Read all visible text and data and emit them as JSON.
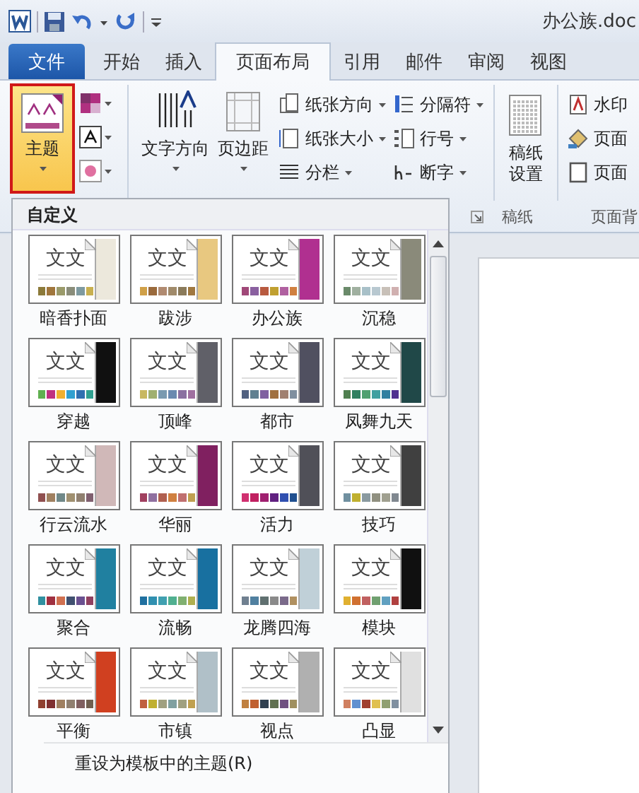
{
  "window": {
    "title": "办公族.doc"
  },
  "tabs": [
    {
      "label": "文件",
      "kind": "file",
      "selected": false
    },
    {
      "label": "开始",
      "kind": "tab",
      "selected": false
    },
    {
      "label": "插入",
      "kind": "tab",
      "selected": false
    },
    {
      "label": "页面布局",
      "kind": "tab",
      "selected": true
    },
    {
      "label": "引用",
      "kind": "tab",
      "selected": false
    },
    {
      "label": "邮件",
      "kind": "tab",
      "selected": false
    },
    {
      "label": "审阅",
      "kind": "tab",
      "selected": false
    },
    {
      "label": "视图",
      "kind": "tab",
      "selected": false
    }
  ],
  "ribbon": {
    "themes_button": {
      "label": "主题",
      "pressed": true
    },
    "large_buttons": [
      {
        "label": "文字方向"
      },
      {
        "label": "页边距"
      }
    ],
    "small_columns": [
      [
        {
          "label": "纸张方向"
        },
        {
          "label": "纸张大小"
        },
        {
          "label": "分栏"
        }
      ],
      [
        {
          "label": "分隔符"
        },
        {
          "label": "行号"
        },
        {
          "label": "断字"
        }
      ]
    ],
    "paper_button": {
      "label": "稿纸设置"
    },
    "background_items": [
      {
        "label": "水印"
      },
      {
        "label": "页面"
      },
      {
        "label": "页面"
      }
    ],
    "group_labels": [
      {
        "label": "稿纸"
      },
      {
        "label": "页面背"
      }
    ]
  },
  "theme_gallery": {
    "heading": "自定义",
    "themes": [
      {
        "name": "暗香扑面",
        "sample": "文文",
        "color": "#ece8dc",
        "swatches": [
          {
            "color": "#8c7a3a"
          },
          {
            "color": "#a0763c"
          },
          {
            "color": "#9a9a6a"
          },
          {
            "color": "#8a8d7a"
          },
          {
            "color": "#7e9aa0"
          },
          {
            "color": "#c8b050"
          }
        ]
      },
      {
        "name": "跋涉",
        "sample": "文文",
        "color": "#e8c880",
        "swatches": [
          {
            "color": "#d0a048"
          },
          {
            "color": "#9a6a3c"
          },
          {
            "color": "#b08a70"
          },
          {
            "color": "#a08a6a"
          },
          {
            "color": "#8a7a5a"
          },
          {
            "color": "#a07840"
          }
        ]
      },
      {
        "name": "办公族",
        "sample": "文文",
        "color": "#b03090",
        "swatches": [
          {
            "color": "#a04878"
          },
          {
            "color": "#8a60a0"
          },
          {
            "color": "#b85a40"
          },
          {
            "color": "#c0a030"
          },
          {
            "color": "#b060a0"
          },
          {
            "color": "#d08040"
          }
        ]
      },
      {
        "name": "沉稳",
        "sample": "文文",
        "color": "#8a8a7a",
        "swatches": [
          {
            "color": "#6a8a6a"
          },
          {
            "color": "#a0b0a0"
          },
          {
            "color": "#a8c0c8"
          },
          {
            "color": "#b8c8d0"
          },
          {
            "color": "#c8c0b8"
          },
          {
            "color": "#d0b0b0"
          }
        ]
      },
      {
        "name": "穿越",
        "sample": "文文",
        "color": "#101010",
        "swatches": [
          {
            "color": "#60b050"
          },
          {
            "color": "#c03080"
          },
          {
            "color": "#f0b030"
          },
          {
            "color": "#30a0d0"
          },
          {
            "color": "#3070b0"
          },
          {
            "color": "#30a090"
          }
        ]
      },
      {
        "name": "顶峰",
        "sample": "文文",
        "color": "#606068",
        "swatches": [
          {
            "color": "#c8b860"
          },
          {
            "color": "#a0b070"
          },
          {
            "color": "#7a9ab0"
          },
          {
            "color": "#6a8ab0"
          },
          {
            "color": "#8a70a0"
          },
          {
            "color": "#a070a0"
          }
        ]
      },
      {
        "name": "都市",
        "sample": "文文",
        "color": "#505060",
        "swatches": [
          {
            "color": "#506080"
          },
          {
            "color": "#608090"
          },
          {
            "color": "#8060a0"
          },
          {
            "color": "#a07040"
          },
          {
            "color": "#a08070"
          },
          {
            "color": "#8090a0"
          }
        ]
      },
      {
        "name": "凤舞九天",
        "sample": "文文",
        "color": "#204848",
        "swatches": [
          {
            "color": "#508050"
          },
          {
            "color": "#308060"
          },
          {
            "color": "#50a070"
          },
          {
            "color": "#40a0a0"
          },
          {
            "color": "#3080a0"
          },
          {
            "color": "#503090"
          }
        ]
      },
      {
        "name": "行云流水",
        "sample": "文文",
        "color": "#d0b8b8",
        "swatches": [
          {
            "color": "#905050"
          },
          {
            "color": "#a08060"
          },
          {
            "color": "#708888"
          },
          {
            "color": "#a09070"
          },
          {
            "color": "#908070"
          },
          {
            "color": "#806070"
          }
        ]
      },
      {
        "name": "华丽",
        "sample": "文文",
        "color": "#802060",
        "swatches": [
          {
            "color": "#a04060"
          },
          {
            "color": "#9070a0"
          },
          {
            "color": "#b06050"
          },
          {
            "color": "#d08040"
          },
          {
            "color": "#c07070"
          },
          {
            "color": "#c0a050"
          }
        ]
      },
      {
        "name": "活力",
        "sample": "文文",
        "color": "#505058",
        "swatches": [
          {
            "color": "#d03070"
          },
          {
            "color": "#c02060"
          },
          {
            "color": "#a02070"
          },
          {
            "color": "#602080"
          },
          {
            "color": "#3050b0"
          },
          {
            "color": "#205090"
          }
        ]
      },
      {
        "name": "技巧",
        "sample": "文文",
        "color": "#404040",
        "swatches": [
          {
            "color": "#7090a0"
          },
          {
            "color": "#c0b030"
          },
          {
            "color": "#8a9aa0"
          },
          {
            "color": "#909080"
          },
          {
            "color": "#a0a090"
          },
          {
            "color": "#808890"
          }
        ]
      },
      {
        "name": "聚合",
        "sample": "文文",
        "color": "#2080a0",
        "swatches": [
          {
            "color": "#3090a0"
          },
          {
            "color": "#a03040"
          },
          {
            "color": "#d07050"
          },
          {
            "color": "#405070"
          },
          {
            "color": "#6a5090"
          },
          {
            "color": "#904060"
          }
        ]
      },
      {
        "name": "流畅",
        "sample": "文文",
        "color": "#1870a0",
        "swatches": [
          {
            "color": "#2070a0"
          },
          {
            "color": "#3090b0"
          },
          {
            "color": "#40a0b0"
          },
          {
            "color": "#50b090"
          },
          {
            "color": "#80b070"
          },
          {
            "color": "#b0b050"
          }
        ]
      },
      {
        "name": "龙腾四海",
        "sample": "文文",
        "color": "#c0d0d8",
        "swatches": [
          {
            "color": "#708090"
          },
          {
            "color": "#5080a0"
          },
          {
            "color": "#607070"
          },
          {
            "color": "#8a8a8a"
          },
          {
            "color": "#7a6a8a"
          },
          {
            "color": "#b09060"
          }
        ]
      },
      {
        "name": "模块",
        "sample": "文文",
        "color": "#101010",
        "swatches": [
          {
            "color": "#e0b030"
          },
          {
            "color": "#d07030"
          },
          {
            "color": "#c06060"
          },
          {
            "color": "#70a070"
          },
          {
            "color": "#60a0c0"
          },
          {
            "color": "#b04040"
          }
        ]
      },
      {
        "name": "平衡",
        "sample": "文文",
        "color": "#d04020",
        "swatches": [
          {
            "color": "#904030"
          },
          {
            "color": "#803030"
          },
          {
            "color": "#a08060"
          },
          {
            "color": "#908070"
          },
          {
            "color": "#806060"
          },
          {
            "color": "#706050"
          }
        ]
      },
      {
        "name": "市镇",
        "sample": "文文",
        "color": "#b0c0c8",
        "swatches": [
          {
            "color": "#c06040"
          },
          {
            "color": "#c0b030"
          },
          {
            "color": "#a0a080"
          },
          {
            "color": "#80a0a0"
          },
          {
            "color": "#a0a080"
          },
          {
            "color": "#c0a050"
          }
        ]
      },
      {
        "name": "视点",
        "sample": "文文",
        "color": "#b0b0b0",
        "swatches": [
          {
            "color": "#c08040"
          },
          {
            "color": "#c06030"
          },
          {
            "color": "#304050"
          },
          {
            "color": "#607050"
          },
          {
            "color": "#705080"
          },
          {
            "color": "#a09060"
          }
        ]
      },
      {
        "name": "凸显",
        "sample": "文文",
        "color": "#e0e0e0",
        "swatches": [
          {
            "color": "#d08060"
          },
          {
            "color": "#6090d0"
          },
          {
            "color": "#a04030"
          },
          {
            "color": "#e0c050"
          },
          {
            "color": "#90a070"
          },
          {
            "color": "#8090a0"
          }
        ]
      }
    ],
    "menu_items": [
      {
        "label": "重设为模板中的主题(R)"
      }
    ]
  }
}
